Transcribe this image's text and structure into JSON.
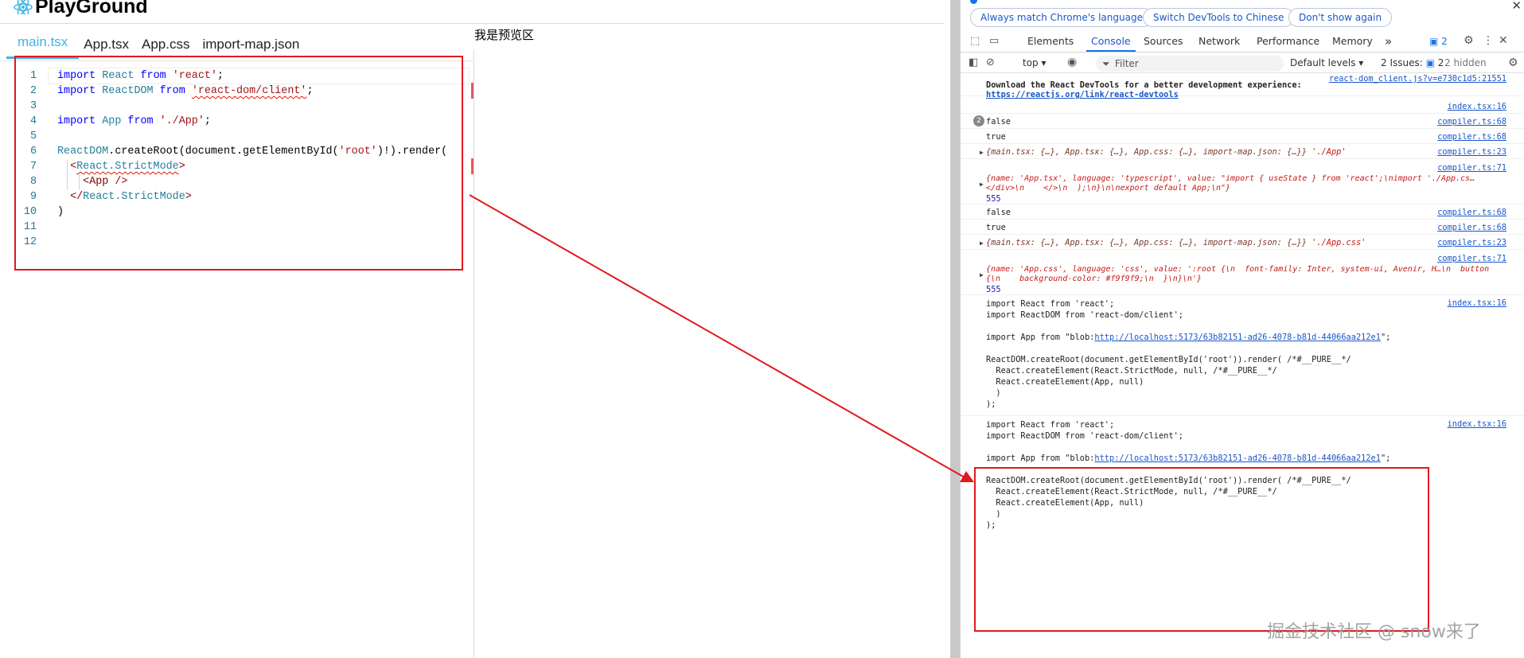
{
  "app": {
    "title": "PlayGround",
    "tabs": [
      "main.tsx",
      "App.tsx",
      "App.css",
      "import-map.json"
    ],
    "active_tab": "main.tsx",
    "preview_label": "我是预览区"
  },
  "editor": {
    "line_numbers": [
      "1",
      "2",
      "3",
      "4",
      "5",
      "6",
      "7",
      "8",
      "9",
      "10",
      "11",
      "12"
    ],
    "code": {
      "l1_kw1": "import",
      "l1_id": "React",
      "l1_kw2": "from",
      "l1_str": "'react'",
      "l1_end": ";",
      "l2_kw1": "import",
      "l2_id": "ReactDOM",
      "l2_kw2": "from",
      "l2_str": "'react-dom/client'",
      "l2_end": ";",
      "l4_kw1": "import",
      "l4_id": "App",
      "l4_kw2": "from",
      "l4_str": "'./App'",
      "l4_end": ";",
      "l6_id": "ReactDOM",
      "l6_a": ".createRoot(document.getElementById(",
      "l6_str": "'root'",
      "l6_b": ")!).render(",
      "l7_a": "<",
      "l7_tag": "React.StrictMode",
      "l7_b": ">",
      "l8_a": "<",
      "l8_tag": "App",
      "l8_b": " />",
      "l9_a": "</",
      "l9_tag": "React.StrictMode",
      "l9_b": ">",
      "l10": ")"
    }
  },
  "devtools": {
    "lang_bar": {
      "btn1": "Always match Chrome's language",
      "btn2": "Switch DevTools to Chinese",
      "btn3": "Don't show again",
      "close": "✕"
    },
    "tabs": [
      "Elements",
      "Console",
      "Sources",
      "Network",
      "Performance",
      "Memory"
    ],
    "active_tab": "Console",
    "more": "»",
    "msg_count": "2",
    "toolbar": {
      "context": "top",
      "filter_placeholder": "Filter",
      "levels": "Default levels",
      "issues_label": "2 Issues:",
      "issues_count": "2",
      "hidden": "2 hidden"
    },
    "console": {
      "m1_src": "react-dom_client.js?v=e730c1d5:21551",
      "m1_text": "Download the React DevTools for a better development experience:",
      "m1_link": "https://reactjs.org/link/react-devtools",
      "m2_src": "index.tsx:16",
      "m3_badge": "2",
      "m3_text": "false",
      "m3_src": "compiler.ts:68",
      "m4_text": "true",
      "m4_src": "compiler.ts:68",
      "m5_text": "{main.tsx: {…}, App.tsx: {…}, App.css: {…}, import-map.json: {…}}",
      "m5_str": "'./App'",
      "m5_src": "compiler.ts:23",
      "m6_src": "compiler.ts:71",
      "m6_line1": "{name: 'App.tsx', language: 'typescript', value: \"import { useState } from 'react';\\nimport './App.cs…",
      "m6_line2": "</div>\\n    </>\\n  );\\n}\\n\\nexport default App;\\n\"}",
      "m6_num": "555",
      "m7_text": "false",
      "m7_src": "compiler.ts:68",
      "m8_text": "true",
      "m8_src": "compiler.ts:68",
      "m9_text": "{main.tsx: {…}, App.tsx: {…}, App.css: {…}, import-map.json: {…}}",
      "m9_str": "'./App.css'",
      "m9_src": "compiler.ts:23",
      "m10_src": "compiler.ts:71",
      "m10_line1": "{name: 'App.css', language: 'css', value: ':root {\\n  font-family: Inter, system-ui, Avenir, H…\\n  button",
      "m10_line2": "{\\n    background-color: #f9f9f9;\\n  }\\n}\\n'}",
      "m10_num": "555",
      "m11_src": "index.tsx:16",
      "code1": "import React from 'react';",
      "code2": "import ReactDOM from 'react-dom/client';",
      "code3_a": "import App from \"blob:",
      "code3_link": "http://localhost:5173/63b82151-ad26-4078-b81d-44066aa212e1",
      "code3_b": "\";",
      "code4": "ReactDOM.createRoot(document.getElementById('root')).render( /*#__PURE__*/",
      "code5": "  React.createElement(React.StrictMode, null, /*#__PURE__*/",
      "code6": "  React.createElement(App, null)",
      "code7": "  )",
      "code8": ");",
      "m12_src": "index.tsx:16"
    }
  },
  "watermark": "掘金技术社区 @ snow来了",
  "colors": {
    "accent": "#41b4e6",
    "annotation": "#e0191d",
    "devtools_blue": "#1a73e8"
  }
}
